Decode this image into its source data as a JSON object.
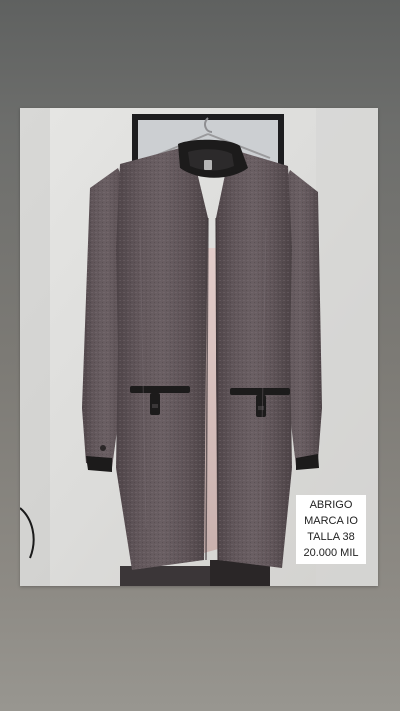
{
  "photo": {
    "subject_icon": "coat-photo"
  },
  "caption": {
    "lines": [
      "ABRIGO",
      "MARCA IO",
      "TALLA 38",
      "20.000 MIL"
    ]
  },
  "colors": {
    "background": "#6d6e6c",
    "wall": "#dcdcda",
    "coat": "#5e5357",
    "leather": "#1c1b1b",
    "lining": "#d8c3c0",
    "caption_bg": "#ffffff",
    "caption_text": "#222222"
  }
}
